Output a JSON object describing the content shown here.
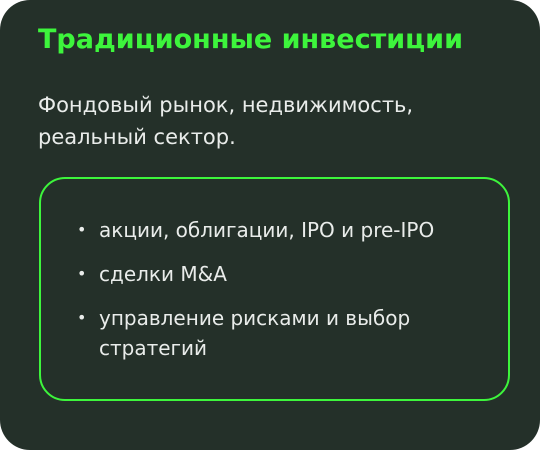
{
  "card": {
    "title": "Традиционные инвестиции",
    "subtitle": "Фондовый рынок, недвижимость, реальный сектор.",
    "bullet_glyph": "•",
    "items": [
      "акции, облигации, IPO и pre-IPO",
      "сделки M&A",
      "управление рисками и выбор стратегий"
    ]
  },
  "colors": {
    "background": "#243029",
    "accent": "#3df53c",
    "text": "#e9ecea"
  }
}
